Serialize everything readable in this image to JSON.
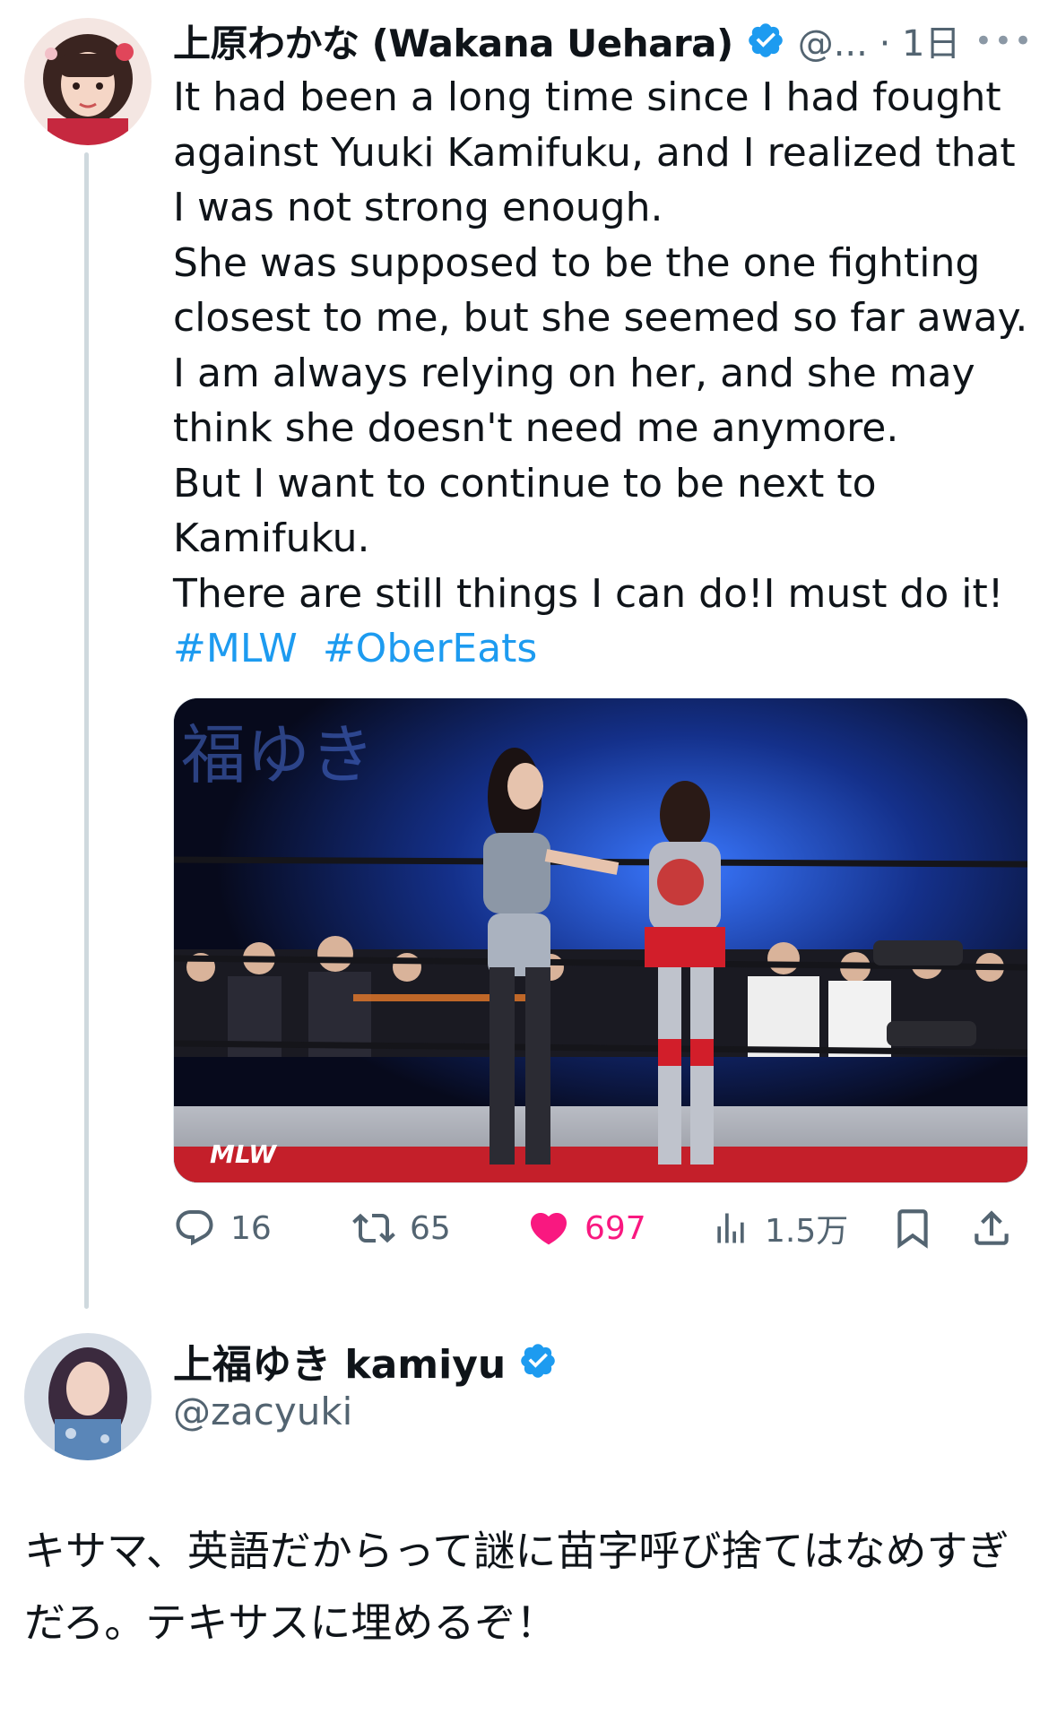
{
  "tweet1": {
    "author_name": "上原わかな (Wakana Uehara)",
    "handle_time": "@... · 1日",
    "more_icon": "•••",
    "text": "It had been a long time since I had fought against Yuuki Kamifuku, and I realized that I was not strong enough.\nShe was supposed to be the one fighting closest to me, but she seemed so far away.\nI am always relying on her, and she may think she doesn't need me anymore.\nBut I want to continue to be next to Kamifuku.\nThere are still things I can do!I must do it!",
    "hashtags": [
      "#MLW",
      "#OberEats"
    ],
    "media": {
      "banner_text": "福ゆき",
      "ring_logo": "MLW"
    },
    "actions": {
      "replies": "16",
      "retweets": "65",
      "likes": "697",
      "views": "1.5万"
    }
  },
  "tweet2": {
    "author_name": "上福ゆき kamiyu",
    "handle": "@zacyuki",
    "text": "キサマ、英語だからって謎に苗字呼び捨てはなめすぎだろ。テキサスに埋めるぞ！"
  },
  "colors": {
    "accent": "#1d9bf0",
    "like": "#f91880",
    "secondary_text": "#536471",
    "thread_line": "#cfd9de"
  }
}
